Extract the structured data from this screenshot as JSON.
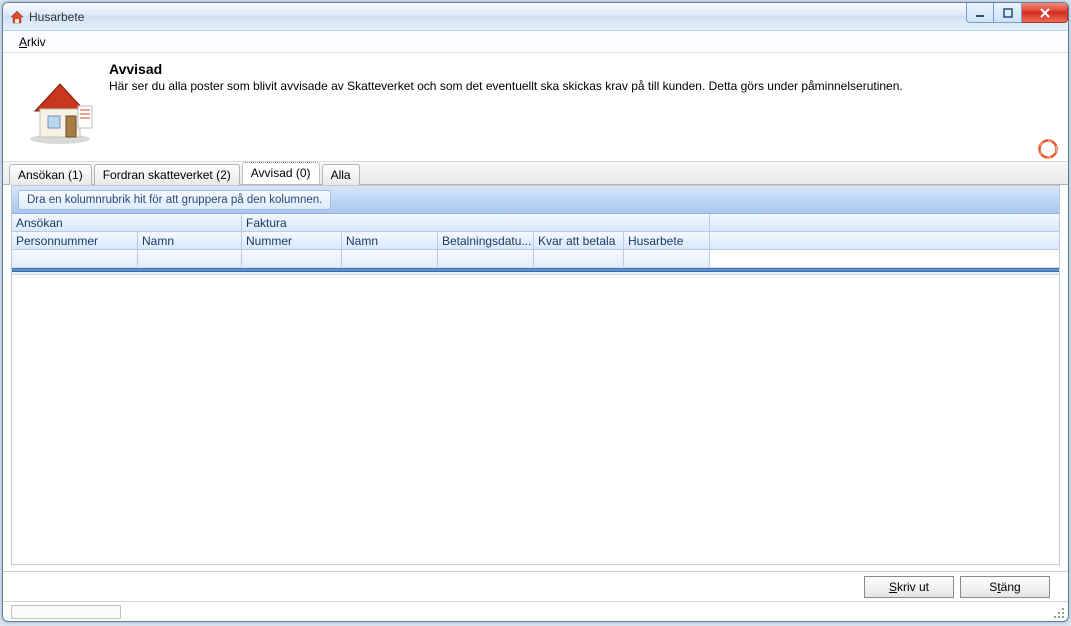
{
  "window": {
    "title": "Husarbete"
  },
  "menubar": {
    "arkiv": "Arkiv"
  },
  "header": {
    "title": "Avvisad",
    "description": "Här ser du alla poster som blivit avvisade av Skatteverket och som det eventuellt ska skickas krav på till kunden. Detta görs under påminnelserutinen."
  },
  "tabs": [
    {
      "label": "Ansökan (1)"
    },
    {
      "label": "Fordran skatteverket (2)"
    },
    {
      "label": "Avvisad (0)"
    },
    {
      "label": "Alla"
    }
  ],
  "active_tab_index": 2,
  "grid": {
    "group_hint": "Dra en kolumnrubrik hit för att gruppera på den kolumnen.",
    "groups": [
      {
        "label": "Ansökan"
      },
      {
        "label": "Faktura"
      }
    ],
    "columns": [
      {
        "label": "Personnummer"
      },
      {
        "label": "Namn"
      },
      {
        "label": "Nummer"
      },
      {
        "label": "Namn"
      },
      {
        "label": "Betalningsdatu..."
      },
      {
        "label": "Kvar att betala"
      },
      {
        "label": "Husarbete"
      }
    ]
  },
  "footer": {
    "print": "Skriv ut",
    "close": "Stäng"
  }
}
